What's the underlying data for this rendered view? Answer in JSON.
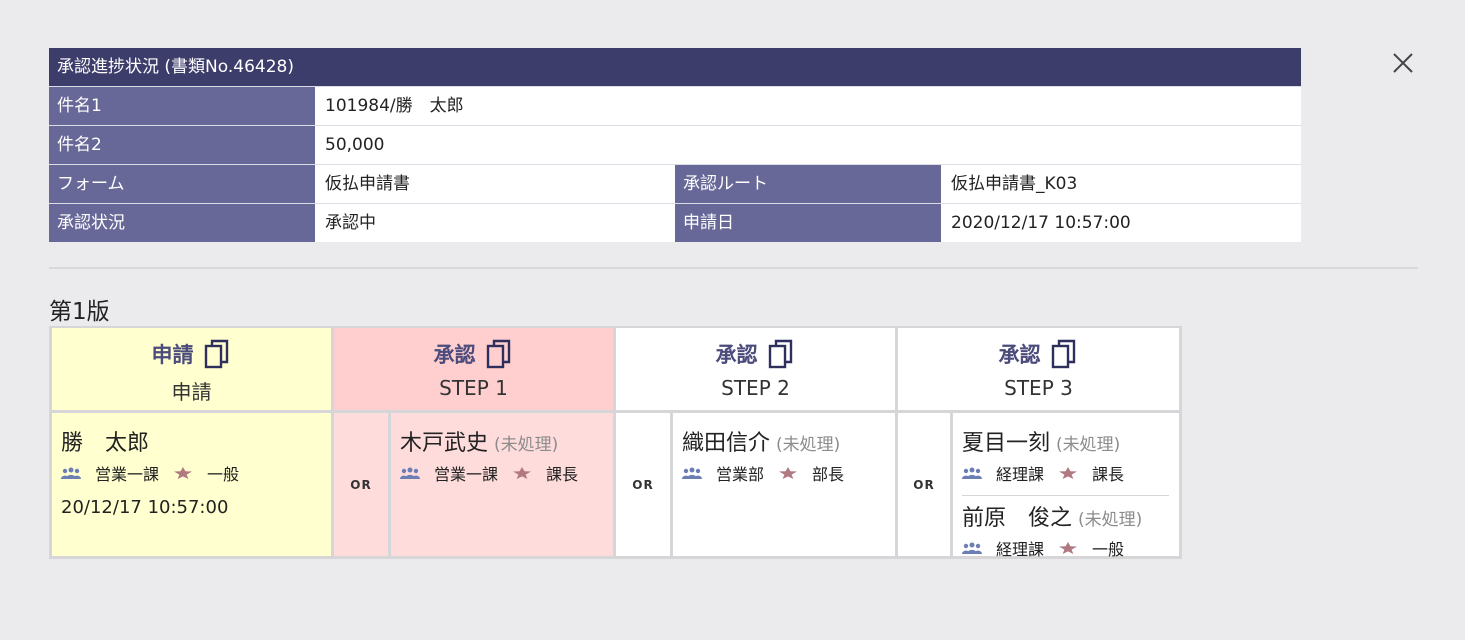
{
  "info": {
    "title": "承認進捗状況 (書類No.46428)",
    "rows": {
      "subject1": {
        "label": "件名1",
        "value": "101984/勝　太郎"
      },
      "subject2": {
        "label": "件名2",
        "value": "50,000"
      },
      "form": {
        "label": "フォーム",
        "value": "仮払申請書"
      },
      "route": {
        "label": "承認ルート",
        "value": "仮払申請書_K03"
      },
      "status": {
        "label": "承認状況",
        "value": "承認中"
      },
      "date": {
        "label": "申請日",
        "value": "2020/12/17 10:57:00"
      }
    }
  },
  "version_label": "第1版",
  "or_label": "OR",
  "steps": [
    {
      "type": "申請",
      "step": "申請"
    },
    {
      "type": "承認",
      "step": "STEP 1"
    },
    {
      "type": "承認",
      "step": "STEP 2"
    },
    {
      "type": "承認",
      "step": "STEP 3"
    }
  ],
  "people": {
    "applicant": {
      "name": "勝　太郎",
      "dept": "営業一課",
      "position": "一般",
      "date": "20/12/17 10:57:00"
    },
    "step1": {
      "name": "木戸武史",
      "status": "(未処理)",
      "dept": "営業一課",
      "position": "課長"
    },
    "step2": {
      "name": "織田信介",
      "status": "(未処理)",
      "dept": "営業部",
      "position": "部長"
    },
    "step3a": {
      "name": "夏目一刻",
      "status": "(未処理)",
      "dept": "経理課",
      "position": "課長"
    },
    "step3b": {
      "name": "前原　俊之",
      "status": "(未処理)",
      "dept": "経理課",
      "position": "一般"
    }
  },
  "icons": {
    "close": "close-icon",
    "copy": "copy-icon",
    "department": "group-icon",
    "position": "star-icon"
  },
  "colors": {
    "title_bar": "#3d3d6b",
    "label_bg": "#686898",
    "applicant_bg": "#ffffcf",
    "current_step_bg": "#ffcfcf",
    "dept_icon": "#6b7fb5",
    "position_icon": "#b07880"
  }
}
